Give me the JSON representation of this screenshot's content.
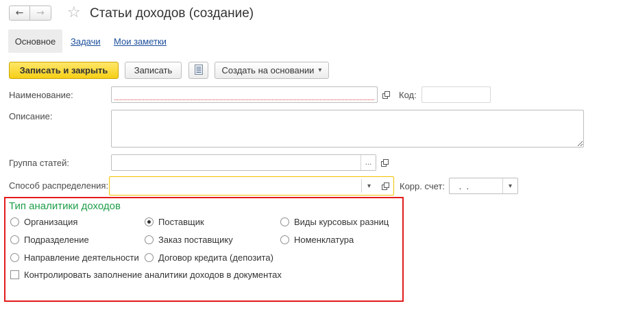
{
  "window": {
    "title": "Статьи доходов (создание)",
    "back_icon": "←",
    "forward_icon": "→",
    "favorite_icon": "☆"
  },
  "tabs": [
    {
      "label": "Основное",
      "active": true
    },
    {
      "label": "Задачи",
      "active": false
    },
    {
      "label": "Мои заметки",
      "active": false
    }
  ],
  "toolbar": {
    "save_close_label": "Записать и закрыть",
    "save_label": "Записать",
    "create_based_label": "Создать на основании",
    "create_based_arrow": "▾"
  },
  "form": {
    "name_label": "Наименование:",
    "name_value": "",
    "code_label": "Код:",
    "code_value": "",
    "description_label": "Описание:",
    "description_value": "",
    "group_label": "Группа статей:",
    "group_value": "",
    "group_select_glyph": "...",
    "distribution_label": "Способ распределения:",
    "distribution_value": "",
    "dropdown_glyph": "▾",
    "corr_account_label": "Корр. счет:",
    "corr_account_value": " .  ."
  },
  "analytics": {
    "title": "Тип аналитики доходов",
    "options": [
      {
        "label": "Организация",
        "checked": false
      },
      {
        "label": "Поставщик",
        "checked": true
      },
      {
        "label": "Виды курсовых разниц",
        "checked": false
      },
      {
        "label": "Подразделение",
        "checked": false
      },
      {
        "label": "Заказ поставщику",
        "checked": false
      },
      {
        "label": "Номенклатура",
        "checked": false
      },
      {
        "label": "Направление деятельности",
        "checked": false
      },
      {
        "label": "Договор кредита (депозита)",
        "checked": false
      }
    ],
    "control_checkbox_label": "Контролировать заполнение аналитики доходов в документах",
    "control_checkbox_checked": false
  },
  "colors": {
    "accent_yellow": "#f6cf16",
    "group_title_green": "#1e9e4a",
    "highlight_red": "#e21b1b",
    "link_blue": "#1c4f9c",
    "focus_border": "#f2c200"
  }
}
